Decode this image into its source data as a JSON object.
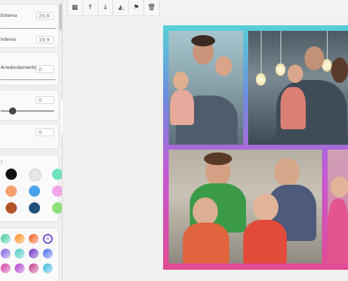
{
  "panel": {
    "field1": {
      "label": "Externa",
      "value": "20,8"
    },
    "field2": {
      "label": "Interna",
      "value": "19,9"
    },
    "field3": {
      "label": "Arredondamento",
      "value": "0"
    },
    "field4": {
      "value": "0"
    },
    "field5": {
      "value": "0"
    }
  },
  "colors": {
    "solid": [
      "#111111",
      "#e6e6e6",
      "#6fe3c0",
      "#f4a16d",
      "#4aa3ea",
      "#f2a6ea",
      "#b4532a",
      "#21507a",
      "#8ee07a"
    ],
    "gradients_row1": [
      "#46c9a0",
      "#ff8c1a",
      "#f45a1a",
      "#ffffff"
    ],
    "gradients_row2": [
      "#7b5ce0",
      "#46c9c4",
      "#6a2cc4",
      "#4a6af0"
    ],
    "gradients_row3": [
      "#d13aa0",
      "#b23ad4",
      "#c23a8a",
      "#3ab6e0"
    ]
  },
  "toolbar": {
    "icons": [
      "checker-icon",
      "arrow-up-icon",
      "arrow-down-icon",
      "flip-icon",
      "flag-icon",
      "trash-icon"
    ],
    "glyphs": [
      "▦",
      "↑",
      "↓",
      "◭",
      "⚑",
      "🗑"
    ]
  },
  "collapse_glyph": "‹"
}
